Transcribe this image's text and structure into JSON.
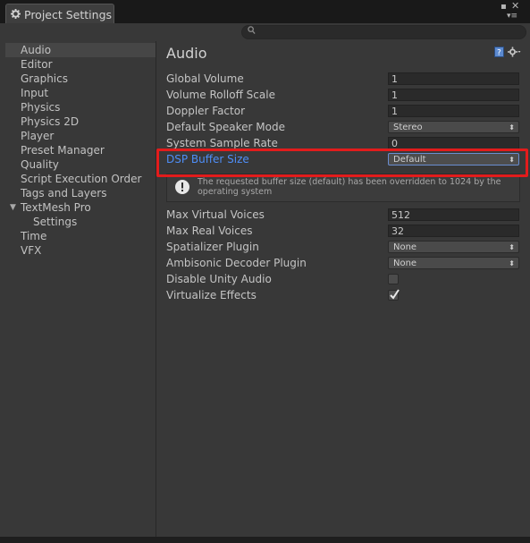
{
  "window": {
    "tab_title": "Project Settings"
  },
  "sidebar": {
    "items": [
      {
        "label": "Audio",
        "selected": true,
        "indent": 0
      },
      {
        "label": "Editor"
      },
      {
        "label": "Graphics"
      },
      {
        "label": "Input"
      },
      {
        "label": "Physics"
      },
      {
        "label": "Physics 2D"
      },
      {
        "label": "Player"
      },
      {
        "label": "Preset Manager"
      },
      {
        "label": "Quality"
      },
      {
        "label": "Script Execution Order"
      },
      {
        "label": "Tags and Layers"
      },
      {
        "label": "TextMesh Pro",
        "expanded": true
      },
      {
        "label": "Settings",
        "child": true
      },
      {
        "label": "Time"
      },
      {
        "label": "VFX"
      }
    ]
  },
  "main": {
    "title": "Audio",
    "fields": {
      "global_volume": {
        "label": "Global Volume",
        "value": "1"
      },
      "volume_rolloff_scale": {
        "label": "Volume Rolloff Scale",
        "value": "1"
      },
      "doppler_factor": {
        "label": "Doppler Factor",
        "value": "1"
      },
      "default_speaker_mode": {
        "label": "Default Speaker Mode",
        "value": "Stereo"
      },
      "system_sample_rate": {
        "label": "System Sample Rate",
        "value": "0"
      },
      "dsp_buffer_size": {
        "label": "DSP Buffer Size",
        "value": "Default"
      },
      "max_virtual_voices": {
        "label": "Max Virtual Voices",
        "value": "512"
      },
      "max_real_voices": {
        "label": "Max Real Voices",
        "value": "32"
      },
      "spatializer_plugin": {
        "label": "Spatializer Plugin",
        "value": "None"
      },
      "ambisonic_decoder_plugin": {
        "label": "Ambisonic Decoder Plugin",
        "value": "None"
      },
      "disable_unity_audio": {
        "label": "Disable Unity Audio",
        "checked": false
      },
      "virtualize_effects": {
        "label": "Virtualize Effects",
        "checked": true
      }
    },
    "warning": {
      "text": "The requested buffer size (default) has been overridden to 1024 by the operating system"
    }
  },
  "colors": {
    "highlight_label": "#4e8ef7",
    "annotation_red": "#e21c1c"
  },
  "icons": [
    "settings-gear-icon",
    "lock-icon",
    "menu-icon",
    "close-icon",
    "search-icon",
    "help-book-icon",
    "gear-icon",
    "warning-icon",
    "expand-arrow-icon",
    "checkmark-icon"
  ]
}
